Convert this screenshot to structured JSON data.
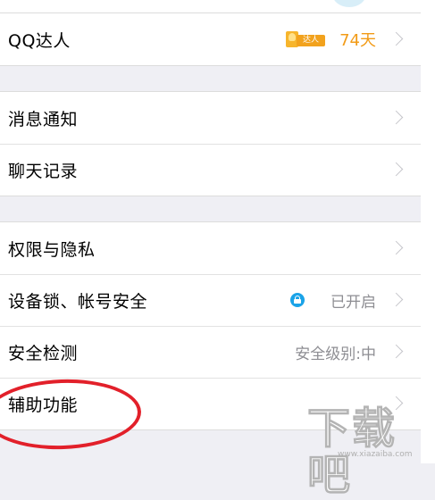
{
  "groups": [
    {
      "rows": [
        {
          "label": "QQ达人",
          "badge_text": "达人",
          "value": "74天"
        }
      ]
    },
    {
      "rows": [
        {
          "label": "消息通知"
        },
        {
          "label": "聊天记录"
        }
      ]
    },
    {
      "rows": [
        {
          "label": "权限与隐私"
        },
        {
          "label": "设备锁、帐号安全",
          "value": "已开启",
          "status_icon": "lock-icon"
        },
        {
          "label": "安全检测",
          "value": "安全级别:中"
        },
        {
          "label": "辅助功能"
        }
      ]
    }
  ],
  "annotation": {
    "color": "#e2202a",
    "highlighted_item": "辅助功能"
  },
  "colors": {
    "background": "#efeff4",
    "accent_orange": "#f29b17",
    "accent_blue": "#1aa3e8",
    "secondary_text": "#8e8e93"
  },
  "watermark": {
    "logo": "下载吧",
    "url": "www.xiazaiba.com"
  }
}
